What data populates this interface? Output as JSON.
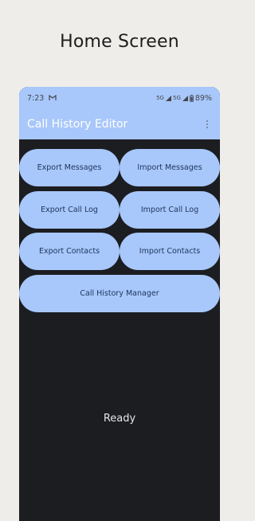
{
  "headline": "Home Screen",
  "status_bar": {
    "time": "7:23",
    "notification_icon": "gmail-icon",
    "signal_labels": [
      "5G",
      "5G"
    ],
    "battery": "89%"
  },
  "app_bar": {
    "title": "Call History Editor",
    "menu_icon": "overflow-menu-icon"
  },
  "buttons": {
    "export_messages": "Export Messages",
    "import_messages": "Import Messages",
    "export_call_log": "Export Call Log",
    "import_call_log": "Import Call Log",
    "export_contacts": "Export Contacts",
    "import_contacts": "Import Contacts",
    "call_history_manager": "Call History Manager"
  },
  "status_text": "Ready",
  "colors": {
    "accent": "#a8c7fa",
    "background": "#1c1d21",
    "page_background": "#efedea"
  }
}
